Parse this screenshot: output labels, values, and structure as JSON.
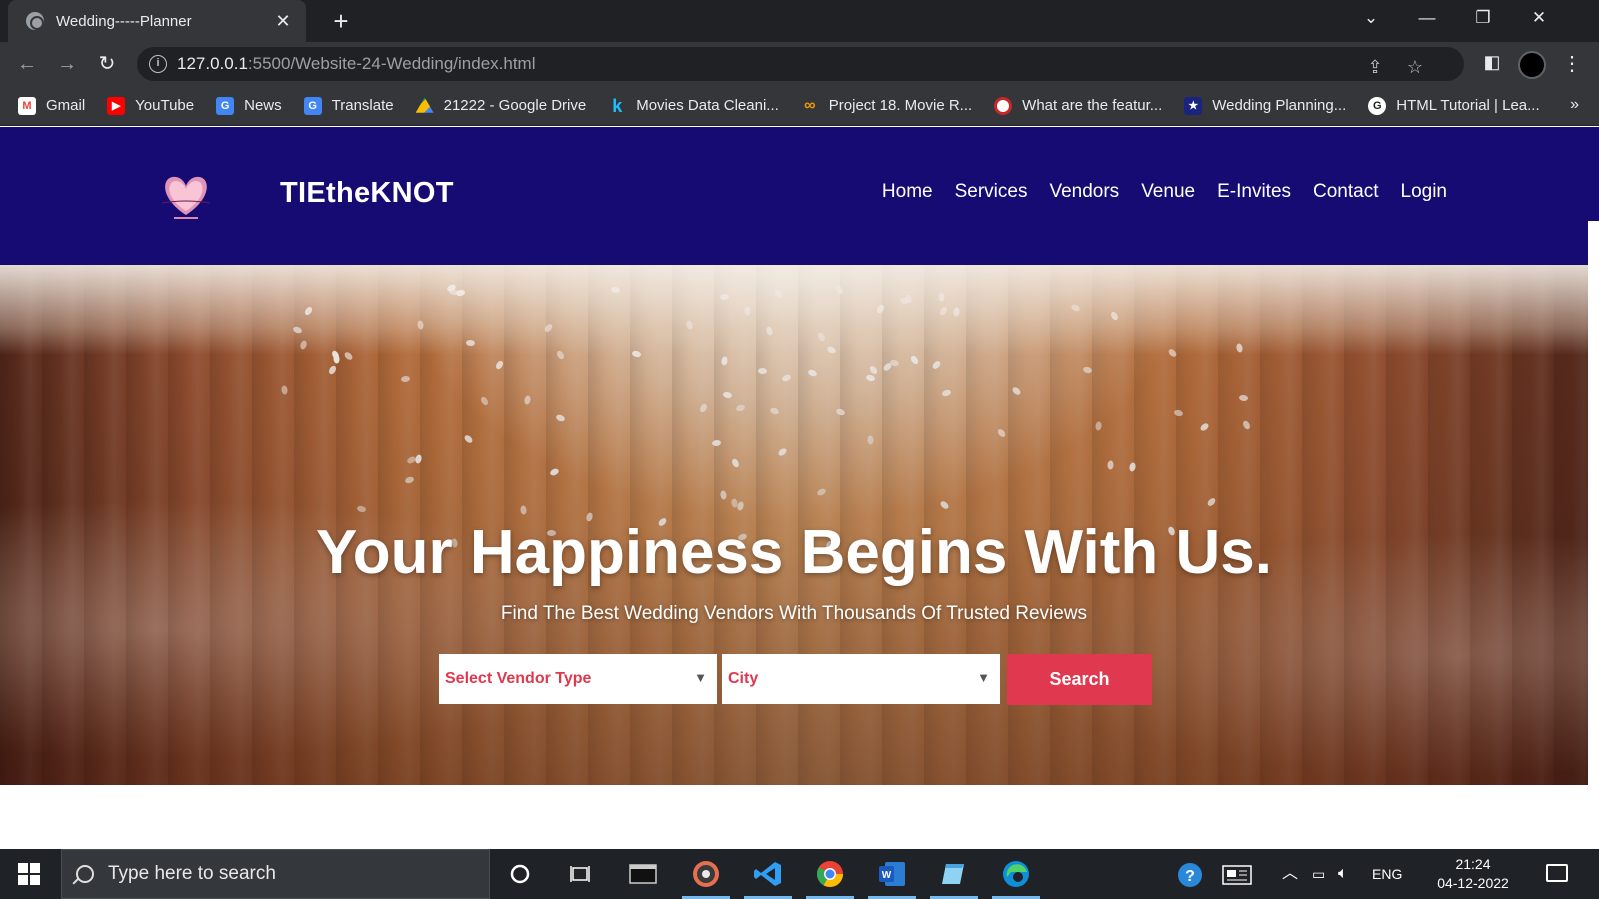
{
  "browser": {
    "tab_title": "Wedding-----Planner",
    "tab_close": "✕",
    "new_tab": "+",
    "url_host": "127.0.0.1",
    "url_path": ":5500/Website-24-Wedding/index.html",
    "bookmarks": [
      {
        "label": "Gmail",
        "icon": "gmail-icon",
        "color": "#ea4335"
      },
      {
        "label": "YouTube",
        "icon": "youtube-icon",
        "color": "#ff0000"
      },
      {
        "label": "News",
        "icon": "news-icon",
        "color": "#4285f4"
      },
      {
        "label": "Translate",
        "icon": "translate-icon",
        "color": "#4285f4"
      },
      {
        "label": "21222 - Google Drive",
        "icon": "google-drive-icon",
        "color": "#fbbc04"
      },
      {
        "label": "Movies Data Cleani...",
        "icon": "kaggle-icon",
        "color": "#20beff"
      },
      {
        "label": "Project 18. Movie R...",
        "icon": "infinity-icon",
        "color": "#f29900"
      },
      {
        "label": "What are the featur...",
        "icon": "site-icon",
        "color": "#c62828"
      },
      {
        "label": "Wedding Planning...",
        "icon": "star-icon",
        "color": "#1a237e"
      },
      {
        "label": "HTML Tutorial | Lea...",
        "icon": "google-icon",
        "color": "#ffffff"
      }
    ],
    "bookmarks_more": "»"
  },
  "site": {
    "brand": "TIEtheKNOT",
    "nav": [
      "Home",
      "Services",
      "Vendors",
      "Venue",
      "E-Invites",
      "Contact",
      "Login"
    ],
    "hero_title": "Your Happiness Begins With Us.",
    "hero_subtitle": "Find The Best Wedding Vendors With Thousands Of Trusted Reviews",
    "vendor_select": "Select Vendor Type",
    "city_select": "City",
    "search_label": "Search",
    "colors": {
      "navbar": "#150b73",
      "accent": "#e0384f"
    }
  },
  "taskbar": {
    "search_placeholder": "Type here to search",
    "language": "ENG",
    "time": "21:24",
    "date": "04-12-2022"
  }
}
